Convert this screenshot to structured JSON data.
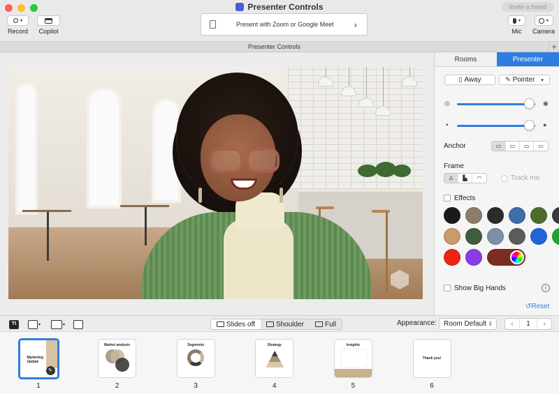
{
  "window": {
    "title": "Presenter Controls",
    "invite_label": "Invite a friend",
    "tab_title": "Presenter Controls"
  },
  "toolbar": {
    "record_label": "Record",
    "copilot_label": "Copilot",
    "present_label": "Present with Zoom or Google Meet",
    "mic_label": "Mic",
    "camera_label": "Camera"
  },
  "panel": {
    "tabs": [
      {
        "label": "Rooms",
        "active": false
      },
      {
        "label": "Presenter",
        "active": true
      }
    ],
    "away_label": "Away",
    "pointer_label": "Pointer",
    "opacity_level": 0.92,
    "size_level": 0.92,
    "anchor_label": "Anchor",
    "frame_label": "Frame",
    "track_me_label": "Track me",
    "effects_label": "Effects",
    "swatch_colors": [
      "#1a1a1a",
      "#8b7d6b",
      "#2b2b2b",
      "#3d6ea8",
      "#4e6b2c",
      "#3a3a3a",
      "#c79b6a",
      "#3f5c3d",
      "#7b8fa8",
      "#5c5c5c",
      "#2166d6",
      "#22a134",
      "#ee2416",
      "#8a3ce6",
      "#7a2e20"
    ],
    "big_hands_label": "Show Big Hands",
    "reset_label": "Reset"
  },
  "bottombar": {
    "tt_label": "Tt",
    "layouts": [
      {
        "label": "Slides off",
        "selected": true
      },
      {
        "label": "Shoulder",
        "selected": false
      },
      {
        "label": "Full",
        "selected": false
      }
    ],
    "appearance_label": "Appearance:",
    "appearance_value": "Room Default",
    "page_value": "1"
  },
  "slides": [
    {
      "num": "1",
      "title": "Marketing Update",
      "selected": true
    },
    {
      "num": "2",
      "title": "Market analysis",
      "selected": false
    },
    {
      "num": "3",
      "title": "Segments",
      "selected": false
    },
    {
      "num": "4",
      "title": "Strategy",
      "selected": false
    },
    {
      "num": "5",
      "title": "Insights",
      "selected": false
    },
    {
      "num": "6",
      "title": "Thank you!",
      "selected": false
    }
  ],
  "colors": {
    "accent": "#2f7de1",
    "close": "#ff5f57",
    "minimize": "#febc2e",
    "maximize": "#28c840"
  }
}
